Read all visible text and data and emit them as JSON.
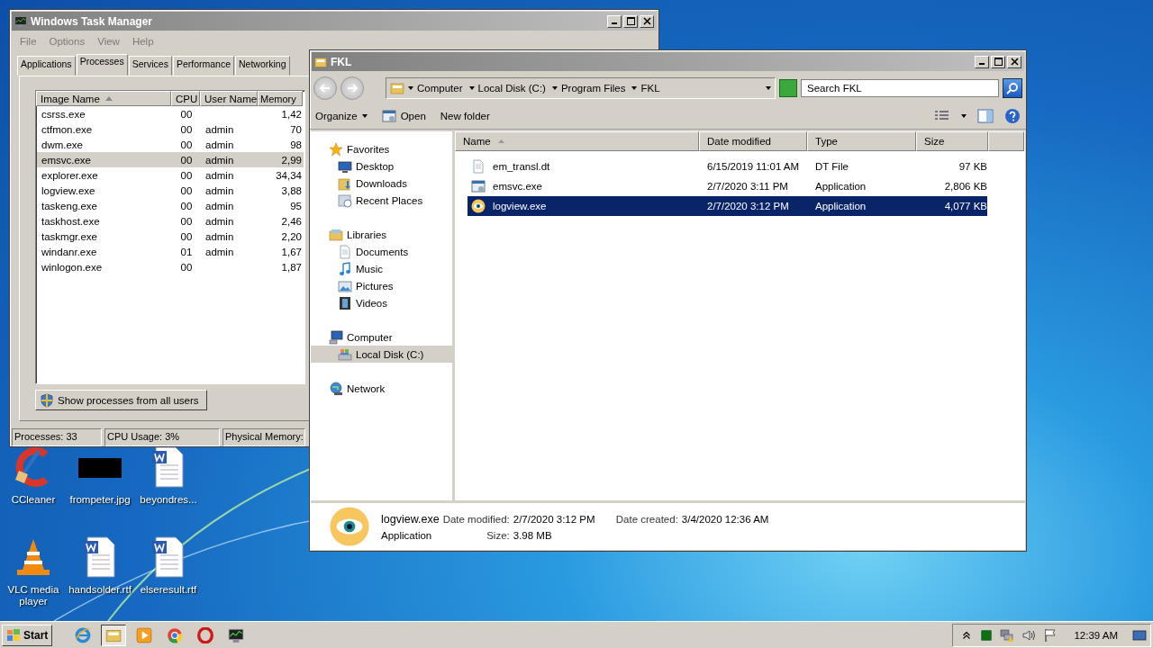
{
  "task_manager": {
    "title": "Windows Task Manager",
    "menu": [
      "File",
      "Options",
      "View",
      "Help"
    ],
    "tabs": [
      {
        "label": "Applications",
        "selected": false
      },
      {
        "label": "Processes",
        "selected": true
      },
      {
        "label": "Services",
        "selected": false
      },
      {
        "label": "Performance",
        "selected": false
      },
      {
        "label": "Networking",
        "selected": false
      }
    ],
    "columns": [
      "Image Name",
      "CPU",
      "User Name",
      "Memory"
    ],
    "rows": [
      {
        "cells": [
          "csrss.exe",
          "00",
          "",
          "1,42"
        ],
        "selected": false
      },
      {
        "cells": [
          "ctfmon.exe",
          "00",
          "admin",
          "70"
        ],
        "selected": false
      },
      {
        "cells": [
          "dwm.exe",
          "00",
          "admin",
          "98"
        ],
        "selected": false
      },
      {
        "cells": [
          "emsvc.exe",
          "00",
          "admin",
          "2,99"
        ],
        "selected": true
      },
      {
        "cells": [
          "explorer.exe",
          "00",
          "admin",
          "34,34"
        ],
        "selected": false
      },
      {
        "cells": [
          "logview.exe",
          "00",
          "admin",
          "3,88"
        ],
        "selected": false
      },
      {
        "cells": [
          "taskeng.exe",
          "00",
          "admin",
          "95"
        ],
        "selected": false
      },
      {
        "cells": [
          "taskhost.exe",
          "00",
          "admin",
          "2,46"
        ],
        "selected": false
      },
      {
        "cells": [
          "taskmgr.exe",
          "00",
          "admin",
          "2,20"
        ],
        "selected": false
      },
      {
        "cells": [
          "windanr.exe",
          "01",
          "admin",
          "1,67"
        ],
        "selected": false
      },
      {
        "cells": [
          "winlogon.exe",
          "00",
          "",
          "1,87"
        ],
        "selected": false
      }
    ],
    "button": "Show processes from all users",
    "status": [
      "Processes: 33",
      "CPU Usage: 3%",
      "Physical Memory:"
    ]
  },
  "explorer": {
    "title": "FKL",
    "breadcrumb": [
      "Computer",
      "Local Disk (C:)",
      "Program Files",
      "FKL"
    ],
    "search": {
      "placeholder": "Search FKL"
    },
    "toolbar": [
      {
        "label": "Organize",
        "kind": "menu"
      },
      {
        "label": "Open",
        "kind": "open"
      },
      {
        "label": "New folder",
        "kind": "plain"
      }
    ],
    "nav": [
      {
        "label": "Favorites",
        "kind": "star",
        "selected": false,
        "children": [
          {
            "label": "Desktop",
            "kind": "desktop",
            "selected": false
          },
          {
            "label": "Downloads",
            "kind": "downloads",
            "selected": false
          },
          {
            "label": "Recent Places",
            "kind": "recent",
            "selected": false
          }
        ]
      },
      {
        "label": "Libraries",
        "kind": "library",
        "selected": false,
        "children": [
          {
            "label": "Documents",
            "kind": "document",
            "selected": false
          },
          {
            "label": "Music",
            "kind": "music",
            "selected": false
          },
          {
            "label": "Pictures",
            "kind": "pictures",
            "selected": false
          },
          {
            "label": "Videos",
            "kind": "videos",
            "selected": false
          }
        ]
      },
      {
        "label": "Computer",
        "kind": "computer",
        "selected": false,
        "children": [
          {
            "label": "Local Disk (C:)",
            "kind": "drive",
            "selected": true
          }
        ]
      },
      {
        "label": "Network",
        "kind": "network",
        "selected": false
      }
    ],
    "columns": [
      "Name",
      "Date modified",
      "Type",
      "Size"
    ],
    "files": [
      {
        "name": "em_transl.dt",
        "date": "6/15/2019 11:01 AM",
        "type": "DT File",
        "size": "97 KB",
        "kind": "file",
        "selected": false
      },
      {
        "name": "emsvc.exe",
        "date": "2/7/2020 3:11 PM",
        "type": "Application",
        "size": "2,806 KB",
        "kind": "app",
        "selected": false
      },
      {
        "name": "logview.exe",
        "date": "2/7/2020 3:12 PM",
        "type": "Application",
        "size": "4,077 KB",
        "kind": "eye",
        "selected": true
      }
    ],
    "details": {
      "name": "logview.exe",
      "type": "Application",
      "modified_label": "Date modified:",
      "modified": "2/7/2020 3:12 PM",
      "created_label": "Date created:",
      "created": "3/4/2020 12:36 AM",
      "size_label": "Size:",
      "size": "3.98 MB"
    }
  },
  "desktop_icons": [
    {
      "label": "CCleaner",
      "kind": "ccleaner"
    },
    {
      "label": "frompeter.jpg",
      "kind": "thumbnail"
    },
    {
      "label": "beyondres...",
      "kind": "word"
    },
    {
      "label": "VLC media player",
      "kind": "vlc"
    },
    {
      "label": "handsolder.rtf",
      "kind": "word"
    },
    {
      "label": "elseresult.rtf",
      "kind": "word"
    }
  ],
  "taskbar": {
    "start": "Start",
    "apps": [
      {
        "kind": "ie",
        "selected": false
      },
      {
        "kind": "folder",
        "selected": true
      },
      {
        "kind": "media",
        "selected": false
      },
      {
        "kind": "chrome",
        "selected": false
      },
      {
        "kind": "opera",
        "selected": false
      },
      {
        "kind": "taskmgr",
        "selected": false
      }
    ],
    "clock": "12:39 AM"
  }
}
